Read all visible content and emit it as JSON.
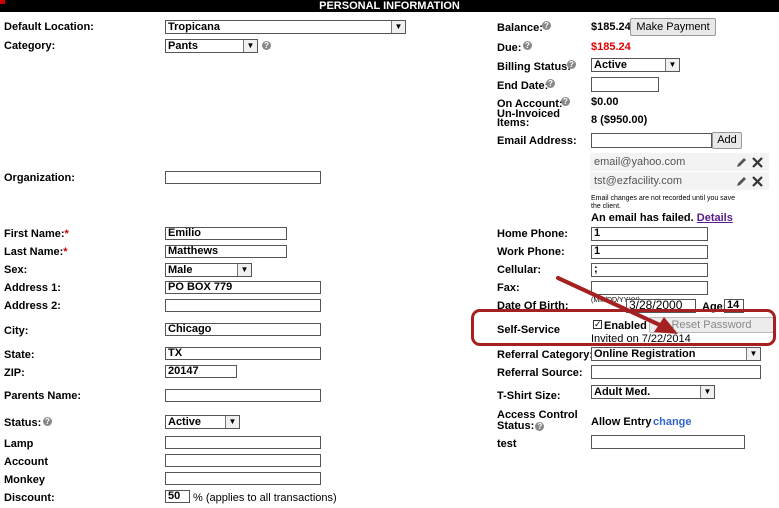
{
  "header": {
    "title": "PERSONAL INFORMATION"
  },
  "left": {
    "default_location_label": "Default Location:",
    "default_location_value": "Tropicana",
    "category_label": "Category:",
    "category_value": "Pants",
    "organization_label": "Organization:",
    "organization_value": "",
    "first_name_label": "First Name:",
    "first_name_value": "Emilio",
    "last_name_label": "Last Name:",
    "last_name_value": "Matthews",
    "required_mark": "*",
    "sex_label": "Sex:",
    "sex_value": "Male",
    "address1_label": "Address 1:",
    "address1_value": "PO BOX 779",
    "address2_label": "Address 2:",
    "address2_value": "",
    "city_label": "City:",
    "city_value": "Chicago",
    "state_label": "State:",
    "state_value": "TX",
    "zip_label": "ZIP:",
    "zip_value": "20147",
    "parents_name_label": "Parents Name:",
    "parents_name_value": "",
    "status_label": "Status:",
    "status_value": "Active",
    "lamp_label": "Lamp",
    "account_label": "Account",
    "monkey_label": "Monkey",
    "discount_label": "Discount:",
    "discount_value": "50",
    "discount_note": "% (applies to all transactions)"
  },
  "right": {
    "balance_label": "Balance:",
    "balance_value": "$185.24",
    "make_payment_label": "Make Payment",
    "due_label": "Due:",
    "due_value": "$185.24",
    "billing_status_label": "Billing Status:",
    "billing_status_value": "Active",
    "end_date_label": "End Date:",
    "on_account_label": "On Account:",
    "on_account_value": "$0.00",
    "uninvoiced_label_1": "Un-Invoiced",
    "uninvoiced_label_2": "Items:",
    "uninvoiced_value": "8 ($950.00)",
    "email_address_label": "Email Address:",
    "add_label": "Add",
    "emails": [
      "email@yahoo.com",
      "tst@ezfacility.com"
    ],
    "email_note_1": "Email changes are not recorded until you save",
    "email_note_2": "the client.",
    "email_failed_text": "An email has failed.",
    "details_link": "Details",
    "home_phone_label": "Home Phone:",
    "home_phone_value": "1",
    "work_phone_label": "Work Phone:",
    "work_phone_value": "1",
    "cellular_label": "Cellular:",
    "cellular_value": ";",
    "fax_label": "Fax:",
    "fax_value": "",
    "dob_label": "Date Of Birth:",
    "dob_format": "(MM/DD/YYYY)",
    "dob_value": "3/28/2000",
    "age_label": "Age:",
    "age_value": "14",
    "self_service_label": "Self-Service",
    "enabled_label": "Enabled",
    "reset_password_label": "Reset Password",
    "invited_text": "Invited on 7/22/2014",
    "referral_category_label": "Referral Category:",
    "referral_category_value": "Online Registration",
    "referral_source_label": "Referral Source:",
    "tshirt_label": "T-Shirt Size:",
    "tshirt_value": "Adult Med.",
    "access_control_label_1": "Access Control",
    "access_control_label_2": "Status:",
    "access_control_value": "Allow Entry",
    "change_link": "change",
    "test_label": "test"
  },
  "icons": {
    "help": "question-circle-icon",
    "edit": "pencil-icon",
    "delete": "x-icon",
    "annotation": "red-arrow"
  },
  "colors": {
    "due": "#e00000",
    "link": "#3366cc",
    "highlight": "#a52020",
    "required": "#cc0000"
  }
}
